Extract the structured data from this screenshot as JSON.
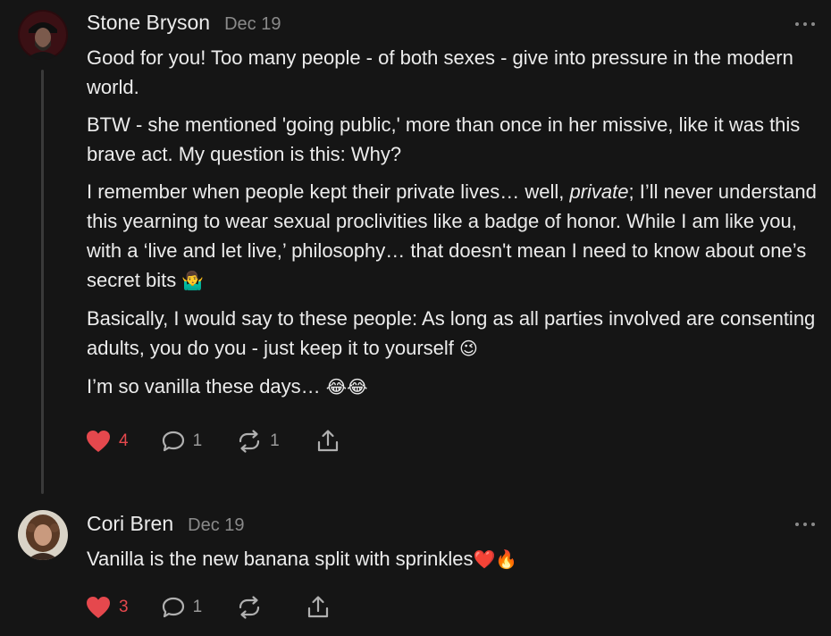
{
  "comments": [
    {
      "author": "Stone Bryson",
      "date": "Dec 19",
      "paragraphs": [
        "Good for you! Too many people - of both sexes - give into pressure in the modern world.",
        "BTW - she mentioned 'going public,' more than once in her missive, like it was this brave act. My question is this: Why?"
      ],
      "para3_before": "I remember when people kept their private lives… well, ",
      "para3_em": "private",
      "para3_after": "; I’ll never understand this yearning to wear sexual proclivities like a badge of honor. While I am like you, with a ‘live and let live,’ philosophy… that doesn't mean I need to know about one’s secret bits ",
      "para3_emoji": "🤷‍♂️",
      "para4_text": "Basically, I would say to these people: As long as all parties involved are consenting adults, you do you - just keep it to yourself ",
      "para4_emoji": "😉",
      "para5_text": "I’m so vanilla these days… ",
      "para5_emoji": "😂😂",
      "likes": "4",
      "replies": "1",
      "restacks": "1"
    },
    {
      "author": "Cori Bren",
      "date": "Dec 19",
      "text": "Vanilla is the new banana split with sprinkles",
      "emoji": "❤️🔥",
      "likes": "3",
      "replies": "1",
      "restacks": ""
    }
  ],
  "colors": {
    "background": "#151515",
    "like_red": "#e5484d",
    "muted": "#8a8a8a"
  },
  "icons": [
    "heart-icon",
    "comment-bubble-icon",
    "restack-icon",
    "share-icon",
    "more-options-icon"
  ]
}
